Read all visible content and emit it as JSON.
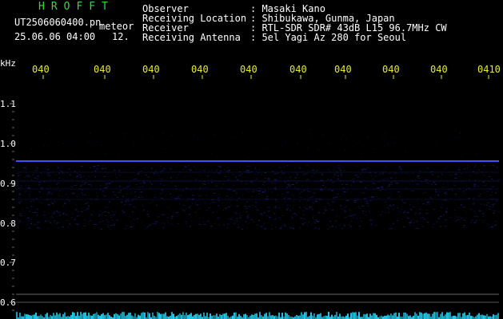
{
  "header": {
    "logo": "HROFFT",
    "filename": "UT2506060400.pn",
    "mode": "meteor",
    "datetime": "25.06.06 04:00",
    "count": "12.",
    "info": [
      {
        "label": "Observer",
        "value": ": Masaki Kano"
      },
      {
        "label": "Receiving Location",
        "value": ": Shibukawa, Gunma, Japan"
      },
      {
        "label": "Receiver",
        "value": ": RTL-SDR SDR# 43dB L15 96.7MHz CW"
      },
      {
        "label": "Receiving Antenna",
        "value": ": 5el Yagi Az 280 for Seoul"
      }
    ]
  },
  "yaxis": {
    "unit": "kHz",
    "ticks": [
      "1.1",
      "1.0",
      "0.9",
      "0.8",
      "0.7",
      "0.6"
    ]
  },
  "xaxis": {
    "ticks": [
      "040",
      "040",
      "040",
      "040",
      "040",
      "040",
      "040",
      "040",
      "040",
      "0410"
    ]
  },
  "colors": {
    "background": "#000000",
    "signal": "#3a55ff",
    "noise": "#1a2288",
    "tick": "#e8e830",
    "activity": "#22ccee"
  }
}
